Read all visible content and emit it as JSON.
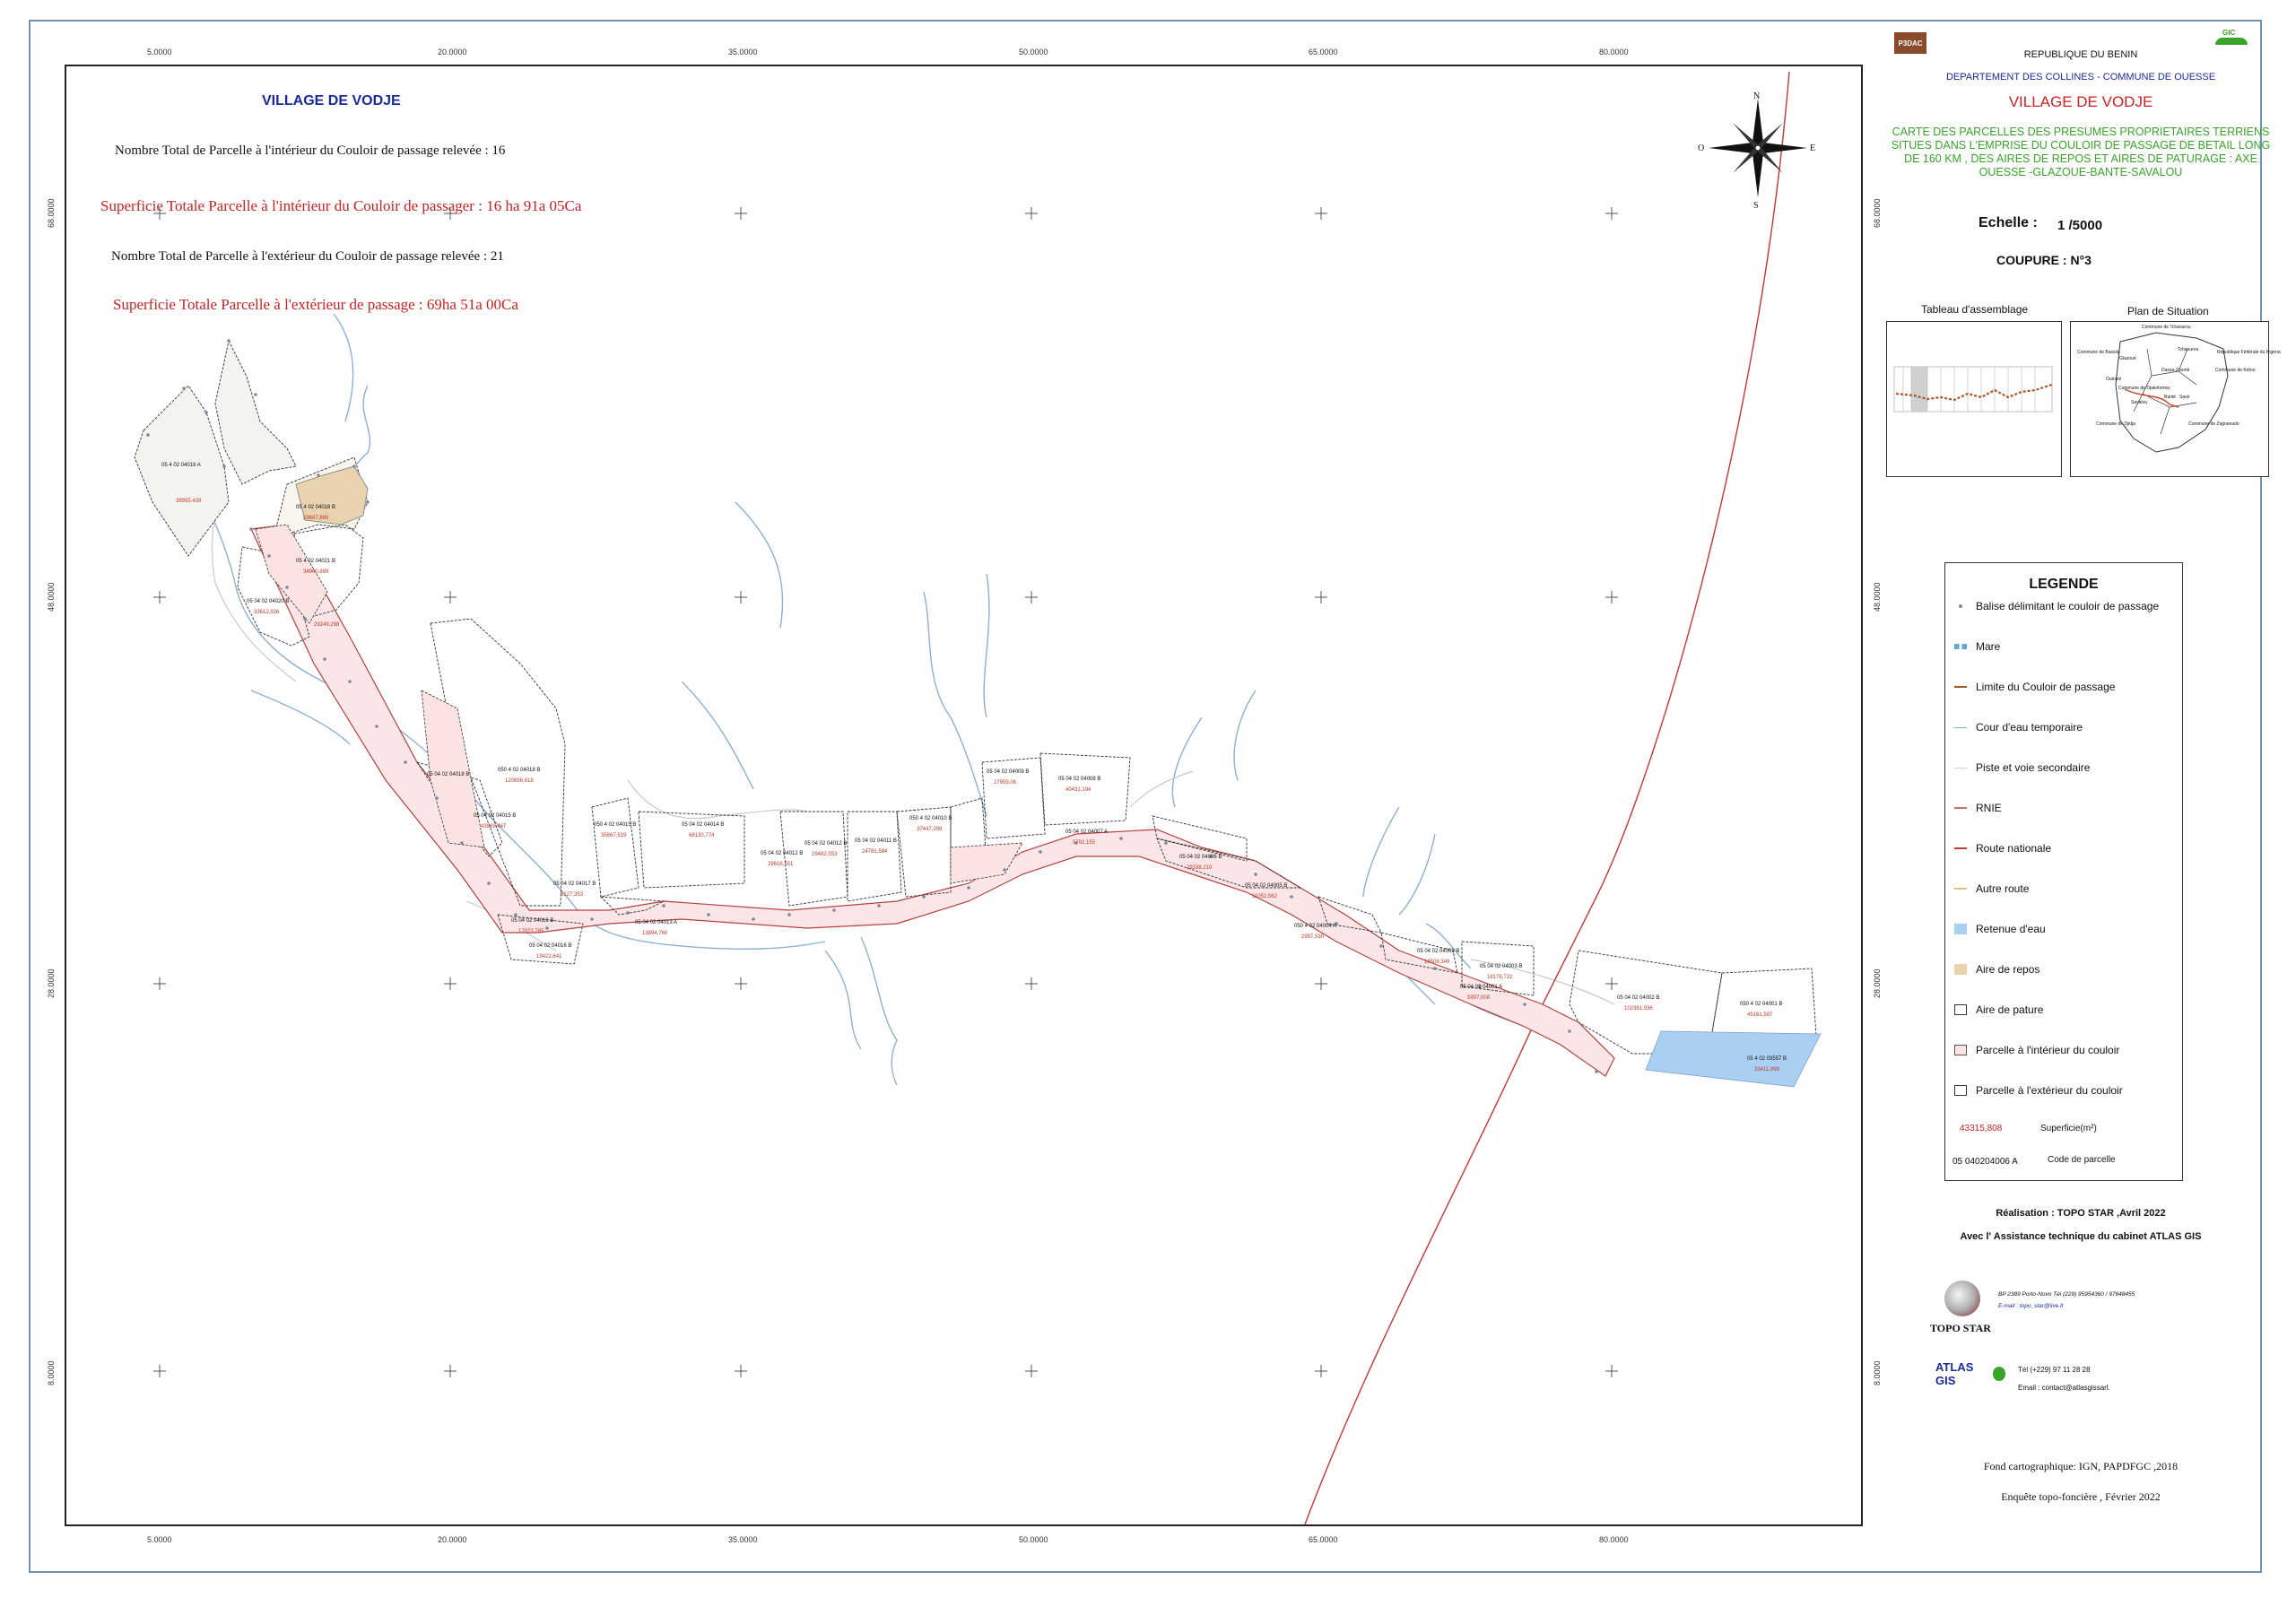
{
  "map": {
    "x_ticks": [
      "5.0000",
      "20.0000",
      "35.0000",
      "50.0000",
      "65.0000",
      "80.0000"
    ],
    "y_ticks": [
      "68.0000",
      "48.0000",
      "28.0000",
      "8.0000"
    ],
    "village_label": "VILLAGE  DE  VODJE",
    "stat1": "Nombre  Total de Parcelle à l'intérieur du Couloir de passage relevée  :  16",
    "stat2": "Superficie Totale Parcelle  à l'intérieur  du Couloir de passager  :  16 ha  91a  05Ca",
    "stat3": "Nombre  Total de Parcelle à l'extérieur  du Couloir de passage relevée  : 21",
    "stat4": "Superficie Totale Parcelle à l'extérieur de passage : 69ha  51a  00Ca",
    "compass": {
      "n": "N",
      "s": "S",
      "e": "E",
      "w": "O"
    },
    "parcels": [
      {
        "code": "05 4 02 04019  A",
        "area": "39955,428"
      },
      {
        "code": "05 4 02 04018  B",
        "area": "29667,865"
      },
      {
        "code": "05 4 02 04021  B",
        "area": "34960,889"
      },
      {
        "code": "05 04 02 04020  B",
        "area": "33612,926"
      },
      {
        "code": "",
        "area": "29249,298"
      },
      {
        "code": "05 04 02 04018  B",
        "area": ""
      },
      {
        "code": "050 4 02 04018  B",
        "area": "120856,618"
      },
      {
        "code": "05 04 02 04015  B",
        "area": "43969,467"
      },
      {
        "code": "050 4 02 04015  B",
        "area": "35867,519"
      },
      {
        "code": "05 04 02 04014  B",
        "area": "68130,774"
      },
      {
        "code": "05 04 02 04017  B",
        "area": "6127,353"
      },
      {
        "code": "05 04 02 04016  B",
        "area": "17022,765"
      },
      {
        "code": "05 04 02 04016  B",
        "area": "19422,641"
      },
      {
        "code": "05 04 02 04013  A",
        "area": "13894,760"
      },
      {
        "code": "05 04 02 04012  B",
        "area": "29616,351"
      },
      {
        "code": "05 04 02 04012  B",
        "area": "29482,553"
      },
      {
        "code": "05 04 02 04011  B",
        "area": "24781,584"
      },
      {
        "code": "050 4 02 04010  B",
        "area": "37447,298"
      },
      {
        "code": "05 04 02 04009  B",
        "area": "27959,06"
      },
      {
        "code": "05 04 02 04008  B",
        "area": "40431,194"
      },
      {
        "code": "05 04 02 04007  A",
        "area": "5792,155"
      },
      {
        "code": "05 04 02 04006  B",
        "area": "29338,210"
      },
      {
        "code": "05 04 02 04005  B",
        "area": "11052,562"
      },
      {
        "code": "050 4 02 04004  A",
        "area": "2957,530"
      },
      {
        "code": "05 04 02 04003  B",
        "area": "18508,349"
      },
      {
        "code": "05 04 02 04003  B",
        "area": "18176,722"
      },
      {
        "code": "05 04 02 04001  A",
        "area": "5997,008"
      },
      {
        "code": "05 04 02 04002  B",
        "area": "102381,936"
      },
      {
        "code": "050 4 02 04001  B",
        "area": "45161,587"
      },
      {
        "code": "05 4 02 03557  B",
        "area": "33411,899"
      }
    ]
  },
  "panel": {
    "logo_left": "P3DAC",
    "logo_right": "GIC",
    "republic": "REPUBLIQUE DU BENIN",
    "department": "DEPARTEMENT DES COLLINES - COMMUNE DE OUESSE",
    "village": "VILLAGE  DE  VODJE",
    "subtitle": "CARTE DES PARCELLES DES PRESUMES PROPRIETAIRES TERRIENS SITUES DANS L'EMPRISE DU COULOIR DE PASSAGE DE BETAIL LONG DE 160 KM , DES  AIRES DE REPOS ET AIRES DE PATURAGE : AXE OUESSE -GLAZOUE-BANTE-SAVALOU",
    "scale_label": "Echelle :",
    "scale_value": "1 /5000",
    "coupure": "COUPURE : N°3",
    "assemblage_title": "Tableau d'assemblage",
    "situation_title": "Plan de Situation",
    "situation_labels": [
      "Commune de Tchaourou",
      "Commune de Bassila",
      "Glazoué",
      "Ouèssè",
      "Tchaourou",
      "République Fédérale du Nigéria",
      "Dassa-Zoumè",
      "Savalou",
      "Bantè",
      "Savè",
      "Commune de Djidja",
      "Commune de Zagnanado",
      "Commune de Kétou",
      "Commune de Djakotomey"
    ]
  },
  "legend": {
    "title": "LEGENDE",
    "items": [
      {
        "label": "Balise délimitant le couloir de passage"
      },
      {
        "label": "Mare"
      },
      {
        "label": "Limite  du  Couloir de passage"
      },
      {
        "label": "Cour d'eau temporaire"
      },
      {
        "label": "Piste et voie secondaire"
      },
      {
        "label": "RNIE"
      },
      {
        "label": "Route nationale"
      },
      {
        "label": "Autre route"
      },
      {
        "label": "Retenue d'eau"
      },
      {
        "label": "Aire  de repos"
      },
      {
        "label": "Aire de pature"
      },
      {
        "label": "Parcelle à l'intérieur du couloir"
      },
      {
        "label": "Parcelle à l'extérieur du couloir"
      }
    ],
    "area_sample": "43315,808",
    "area_label": "Superficie(m²)",
    "code_sample": "05 040204006 A",
    "code_label": "Code de parcelle"
  },
  "credits": {
    "realisation": "Réalisation : TOPO STAR ,Avril 2022",
    "assistance": "Avec l' Assistance technique du cabinet  ATLAS GIS",
    "topostar_contact": "BP 2389 Porto-Novo Tél (229) 95954360 / 97648455",
    "topostar_email": "E-mail : topo_star@live.fr",
    "topostar_name": "TOPO STAR",
    "atlas_logo": "ATLAS GIS",
    "atlas_tel": "Tél (+229) 97 11 28 28",
    "atlas_email": "Email : contact@atlasgissarl.",
    "fond": "Fond cartographique: IGN, PAPDFGC ,2018",
    "enquete": "Enquête topo-foncière , Février 2022"
  },
  "colors": {
    "frame": "#6f93b4",
    "title_blue": "#1a2a9c",
    "title_red": "#cc2222",
    "subtitle_green": "#3aa32a",
    "parcel_red": "#c0392b",
    "river": "#7aa0c8",
    "retenue": "#a6cdf0",
    "repos": "#e5cfa8",
    "corridor_fill": "#f7dede"
  }
}
